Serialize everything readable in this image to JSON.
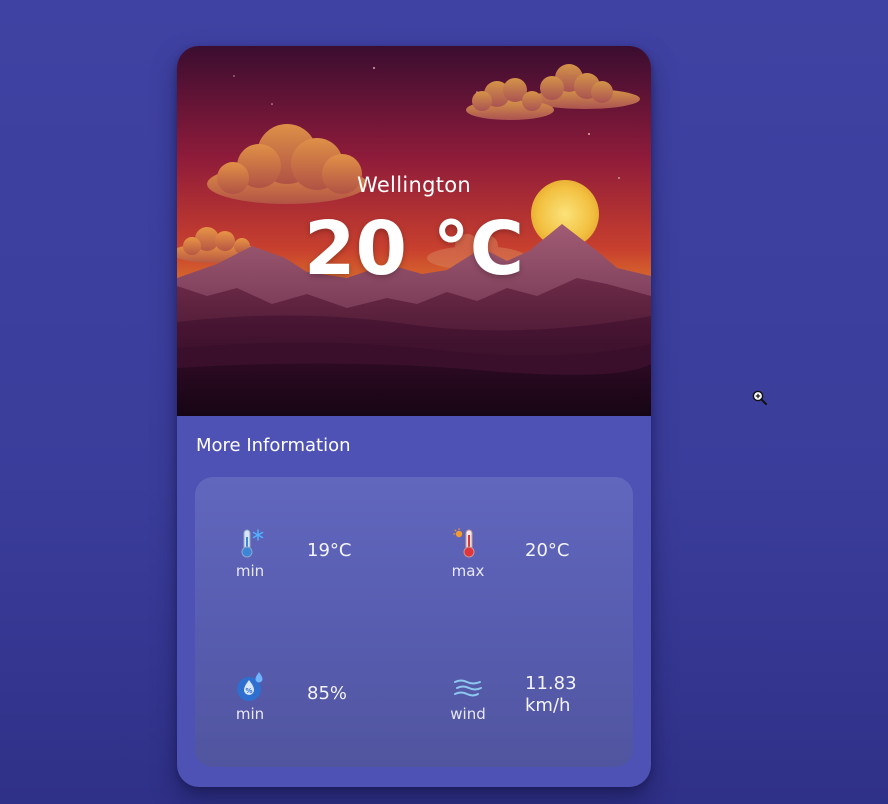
{
  "weather": {
    "city": "Wellington",
    "temperature": "20 °C"
  },
  "more_info": {
    "title": "More Information",
    "items": [
      {
        "icon": "thermometer-cold-icon",
        "label": "min",
        "value": "19°C"
      },
      {
        "icon": "thermometer-hot-icon",
        "label": "max",
        "value": "20°C"
      },
      {
        "icon": "humidity-drop-icon",
        "label": "min",
        "value": "85%"
      },
      {
        "icon": "wind-icon",
        "label": "wind",
        "value_line1": "11.83",
        "value_line2": "km/h"
      }
    ]
  },
  "colors": {
    "background": "#3d3fa0",
    "card": "#4e52b5",
    "panel": "#5a5fb4",
    "sky_top": "#3b0f2e",
    "sky_mid": "#a3203a",
    "sky_low": "#e39628",
    "sun": "#f3c545"
  }
}
